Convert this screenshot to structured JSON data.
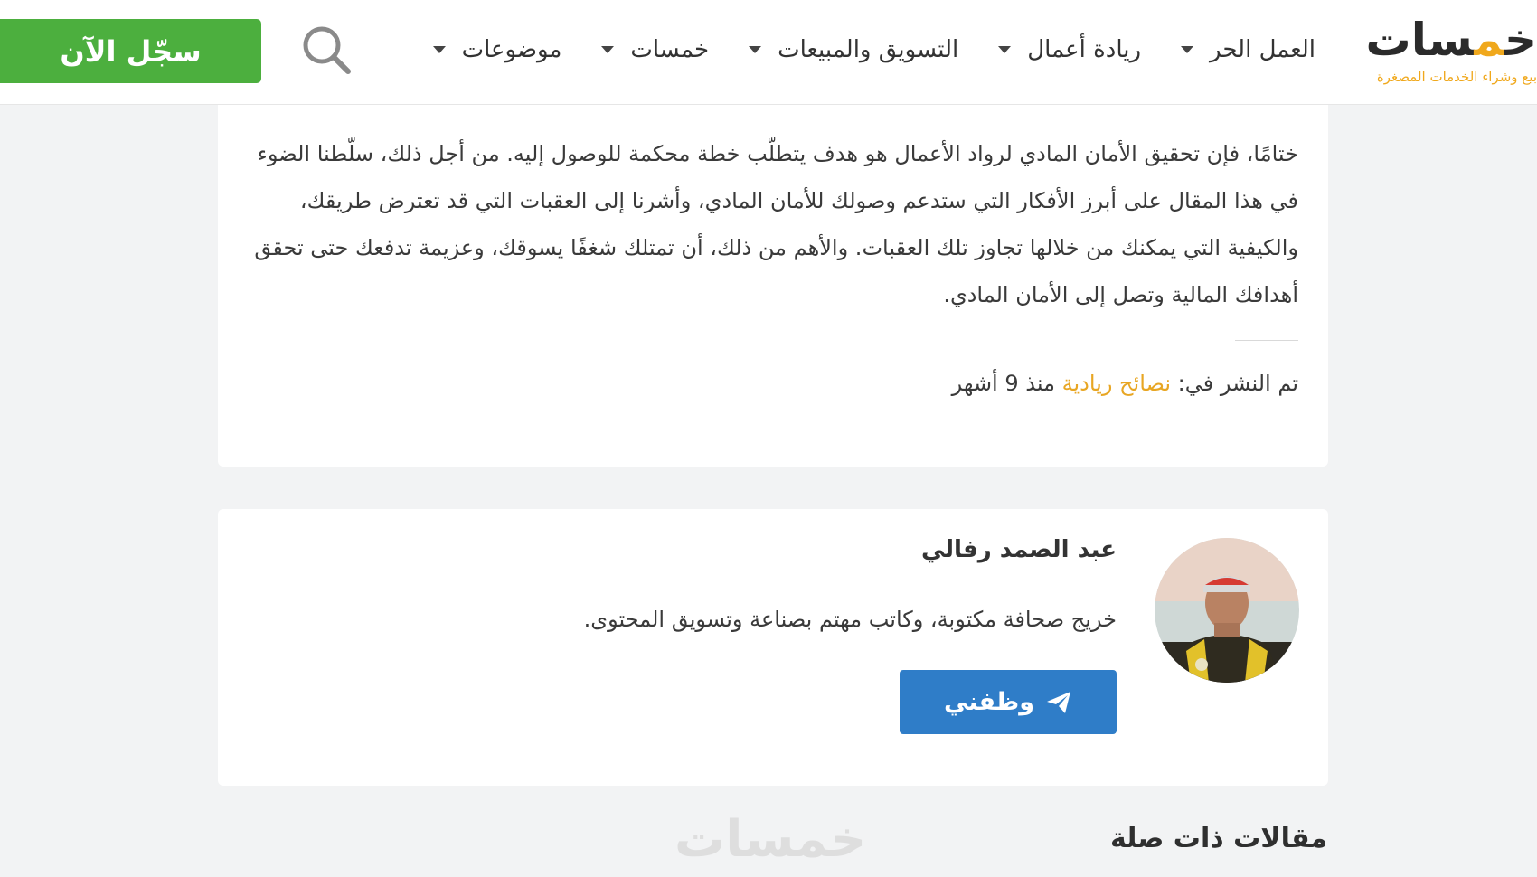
{
  "header": {
    "logo": {
      "word_main": "خمسات",
      "tagline": "بيع وشراء الخدمات المصغرة"
    },
    "nav": [
      {
        "label": "العمل الحر"
      },
      {
        "label": "ريادة أعمال"
      },
      {
        "label": "التسويق والمبيعات"
      },
      {
        "label": "خمسات"
      },
      {
        "label": "موضوعات"
      }
    ],
    "register_label": "سجّل الآن"
  },
  "article": {
    "paragraph": "ختامًا، فإن تحقيق الأمان المادي لرواد الأعمال هو هدف يتطلّب خطة محكمة للوصول إليه. من أجل ذلك، سلّطنا الضوء في هذا المقال على أبرز الأفكار التي ستدعم وصولك للأمان المادي، وأشرنا إلى العقبات التي قد تعترض طريقك، والكيفية التي يمكنك من خلالها تجاوز تلك العقبات. والأهم من ذلك، أن تمتلك شغفًا يسوقك، وعزيمة تدفعك حتى تحقق أهدافك المالية وتصل إلى الأمان المادي.",
    "published_prefix": "تم النشر في: ",
    "category": "نصائح ريادية",
    "published_suffix": " منذ 9 أشهر"
  },
  "author": {
    "name": "عبد الصمد رفالي",
    "bio": "خريج صحافة مكتوبة، وكاتب مهتم بصناعة وتسويق المحتوى.",
    "hire_label": "وظفني"
  },
  "related": {
    "title": "مقالات ذات صلة",
    "watermark": "خمسات"
  },
  "colors": {
    "brand_orange": "#f0a81c",
    "register_green": "#4caf3e",
    "hire_blue": "#2f7dc8"
  }
}
